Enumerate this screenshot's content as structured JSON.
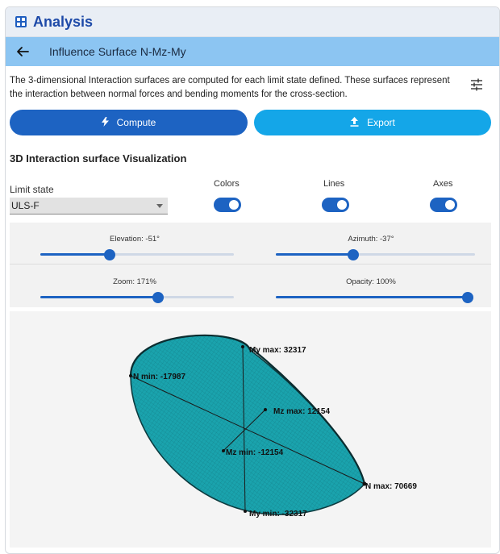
{
  "app": {
    "title": "Analysis",
    "icon": "dashboard-grid-icon"
  },
  "header": {
    "back_icon": "arrow-left-icon",
    "title": "Influence Surface N-Mz-My"
  },
  "description": "The 3-dimensional Interaction surfaces are computed for each limit state defined. These surfaces represent the interaction between normal forces and bending moments for the cross-section.",
  "settings_icon": "tune-sliders-icon",
  "buttons": {
    "compute": {
      "label": "Compute",
      "icon": "lightning-icon"
    },
    "export": {
      "label": "Export",
      "icon": "upload-icon"
    }
  },
  "section_title": "3D Interaction surface Visualization",
  "limit_state": {
    "label": "Limit state",
    "value": "ULS-F"
  },
  "toggles": [
    {
      "label": "Colors",
      "on": true
    },
    {
      "label": "Lines",
      "on": true
    },
    {
      "label": "Axes",
      "on": true
    }
  ],
  "sliders": {
    "elevation": {
      "label": "Elevation: -51°",
      "fraction": 0.36
    },
    "azimuth": {
      "label": "Azimuth: -37°",
      "fraction": 0.39
    },
    "zoom": {
      "label": "Zoom: 171%",
      "fraction": 0.61
    },
    "opacity": {
      "label": "Opacity: 100%",
      "fraction": 1.0
    }
  },
  "surface": {
    "color": "#1aa3ad",
    "labels": {
      "my_max": "My max: 32317",
      "n_min": "N min: -17987",
      "mz_max": "Mz max: 12154",
      "mz_min": "Mz min: -12154",
      "n_max": "N max: 70669",
      "my_min": "My min: -32317"
    }
  },
  "colors": {
    "primary": "#1d63c2",
    "secondary": "#14a6e8",
    "header_bg": "#8cc5f2"
  }
}
